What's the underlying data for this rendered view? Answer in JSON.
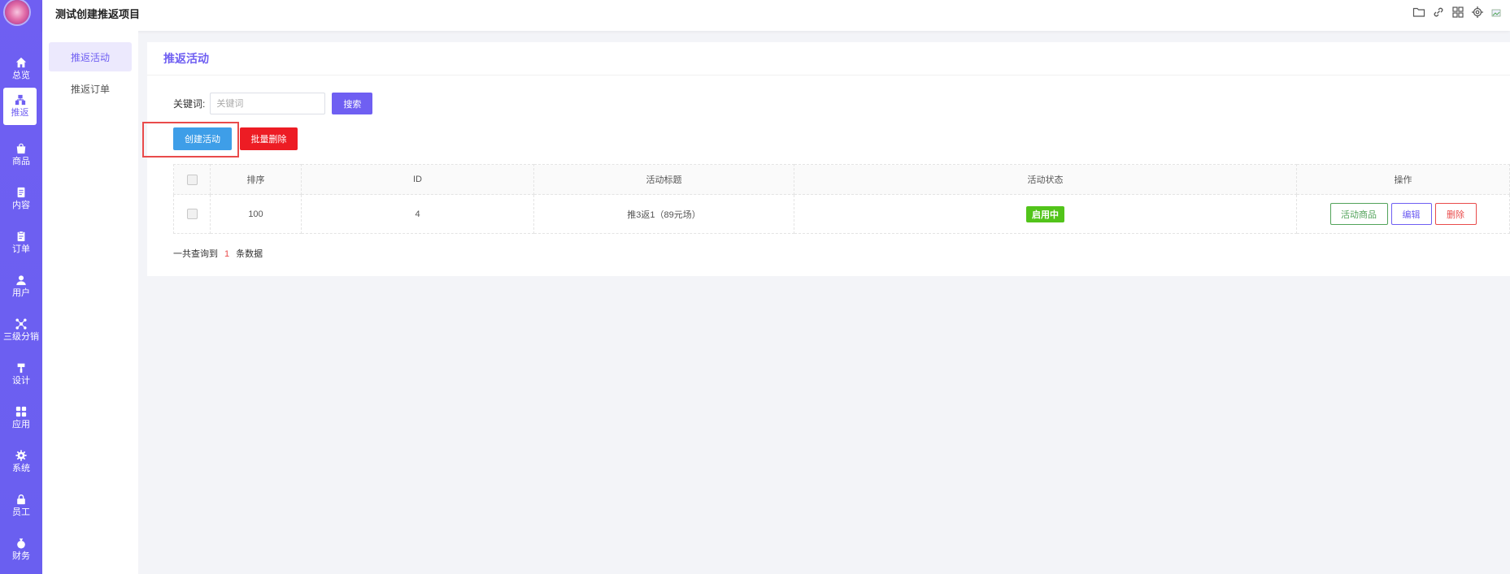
{
  "header": {
    "title": "测试创建推返项目"
  },
  "rail": {
    "items": [
      {
        "label": "总览",
        "icon": "home-icon"
      },
      {
        "label": "推返",
        "icon": "referral-icon"
      },
      {
        "label": "商品",
        "icon": "bag-icon"
      },
      {
        "label": "内容",
        "icon": "document-icon"
      },
      {
        "label": "订单",
        "icon": "clipboard-icon"
      },
      {
        "label": "用户",
        "icon": "user-icon"
      },
      {
        "label": "三级分销",
        "icon": "network-icon"
      },
      {
        "label": "设计",
        "icon": "brush-icon"
      },
      {
        "label": "应用",
        "icon": "apps-icon"
      },
      {
        "label": "系统",
        "icon": "gear-icon"
      },
      {
        "label": "员工",
        "icon": "lock-icon"
      },
      {
        "label": "财务",
        "icon": "moneybag-icon"
      }
    ],
    "active_index": 1
  },
  "subnav": {
    "items": [
      {
        "label": "推返活动"
      },
      {
        "label": "推返订单"
      }
    ]
  },
  "card": {
    "title": "推返活动",
    "search": {
      "label": "关键词:",
      "placeholder": "关键词",
      "button": "搜索"
    },
    "actions": {
      "create": "创建活动",
      "batch_delete": "批量删除"
    },
    "table": {
      "columns": [
        "排序",
        "ID",
        "活动标题",
        "活动状态",
        "操作"
      ],
      "rows": [
        {
          "sort": "100",
          "id": "4",
          "title": "推3返1（89元场）",
          "status": "启用中",
          "ops": {
            "goods": "活动商品",
            "edit": "编辑",
            "delete": "删除"
          }
        }
      ]
    },
    "summary": {
      "prefix": "一共查询到",
      "count": "1",
      "suffix": "条数据"
    }
  },
  "colors": {
    "accent": "#6f5ff2",
    "create_button": "#3e9ee8",
    "delete_button": "#ed1c24",
    "status_active": "#52c41a"
  }
}
